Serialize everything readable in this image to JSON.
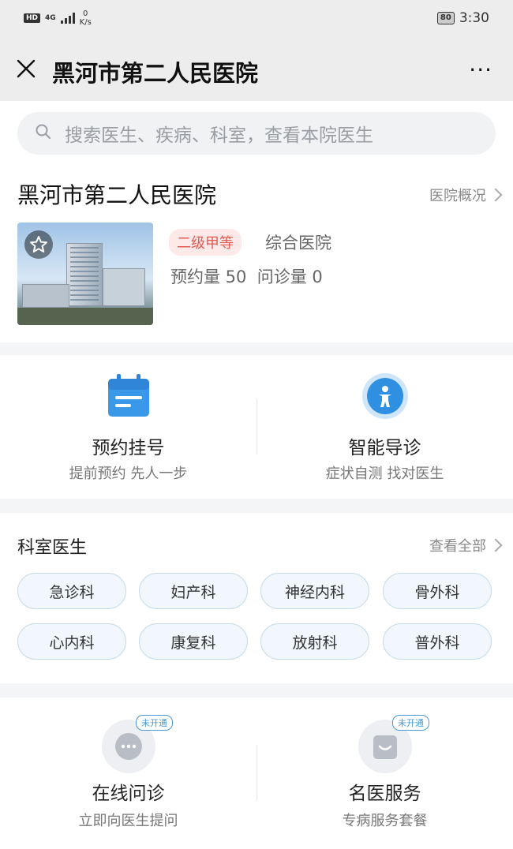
{
  "status_bar": {
    "hd_label": "HD",
    "network_type": "4G",
    "speed_value": "0",
    "speed_unit": "K/s",
    "battery": "80",
    "time": "3:30"
  },
  "nav": {
    "title": "黑河市第二人民医院",
    "close_icon": "close-icon",
    "more_label": "···"
  },
  "search": {
    "placeholder": "搜索医生、疾病、科室，查看本院医生",
    "icon": "search-icon"
  },
  "hospital": {
    "name": "黑河市第二人民医院",
    "overview_link": "医院概况",
    "grade_badge": "二级甲等",
    "type": "综合医院",
    "stats_text": "预约量 50  问诊量 0"
  },
  "services_primary": [
    {
      "title": "预约挂号",
      "subtitle": "提前预约 先人一步",
      "icon": "calendar-icon"
    },
    {
      "title": "智能导诊",
      "subtitle": "症状自测 找对医生",
      "icon": "person-guide-icon"
    }
  ],
  "departments": {
    "title": "科室医生",
    "view_all": "查看全部",
    "items": [
      "急诊科",
      "妇产科",
      "神经内科",
      "骨外科",
      "心内科",
      "康复科",
      "放射科",
      "普外科"
    ]
  },
  "services_secondary": [
    {
      "title": "在线问诊",
      "subtitle": "立即向医生提问",
      "badge": "未开通",
      "icon": "chat-bubble-icon"
    },
    {
      "title": "名医服务",
      "subtitle": "专病服务套餐",
      "badge": "未开通",
      "icon": "smile-bag-icon"
    }
  ],
  "colors": {
    "accent_blue": "#2f8fe0",
    "grade_red": "#e25a52",
    "chip_border": "#c7dcea"
  }
}
